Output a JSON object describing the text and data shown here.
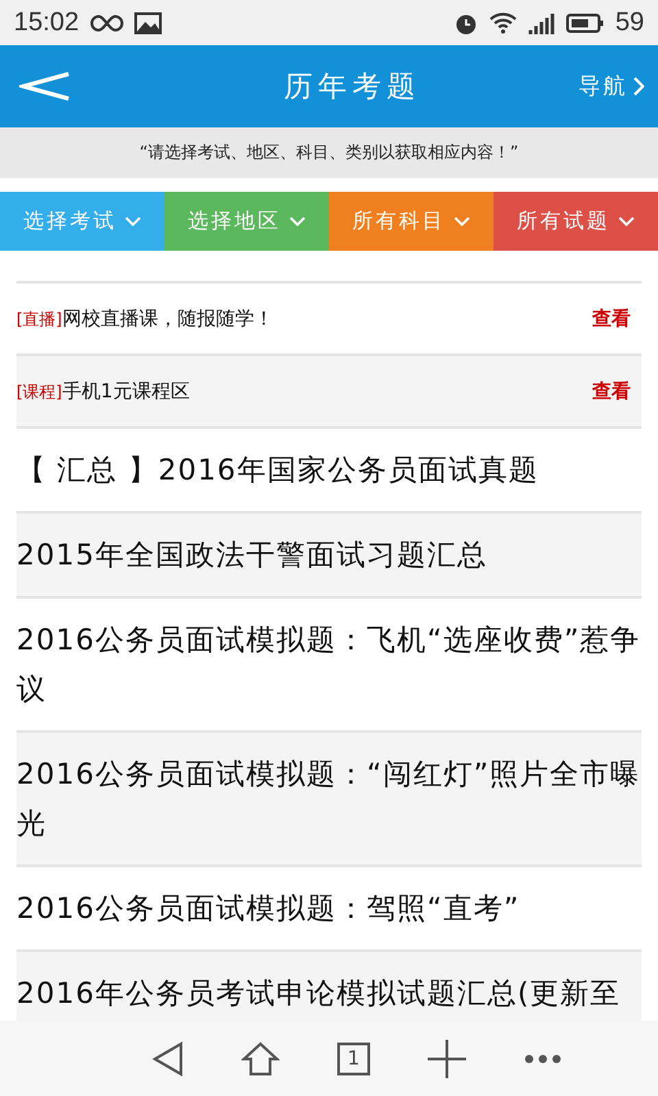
{
  "status_bar": {
    "time": "15:02",
    "battery": "59"
  },
  "header": {
    "title": "历年考题",
    "nav": "导航"
  },
  "notice": "“请选择考试、地区、科目、类别以获取相应内容！”",
  "filters": [
    {
      "label": "选择考试",
      "color": "#33aeea"
    },
    {
      "label": "选择地区",
      "color": "#5cb85c"
    },
    {
      "label": "所有科目",
      "color": "#f0801f"
    },
    {
      "label": "所有试题",
      "color": "#dc5048"
    }
  ],
  "promos": [
    {
      "tag": "[直播]",
      "text": "网校直播课，随报随学！",
      "action": "查看"
    },
    {
      "tag": "[课程]",
      "text": "手机1元课程区",
      "action": "查看"
    }
  ],
  "articles": [
    {
      "title": "【 汇总 】2016年国家公务员面试真题"
    },
    {
      "title": "2015年全国政法干警面试习题汇总"
    },
    {
      "title": "2016公务员面试模拟题：飞机“选座收费”惹争议"
    },
    {
      "title": "2016公务员面试模拟题：“闯红灯”照片全市曝光"
    },
    {
      "title": "2016公务员面试模拟题：驾照“直考”"
    },
    {
      "title": "2016年公务员考试申论模拟试题汇总(更新至"
    }
  ],
  "bottom_bar": {
    "tab_count": "1"
  }
}
